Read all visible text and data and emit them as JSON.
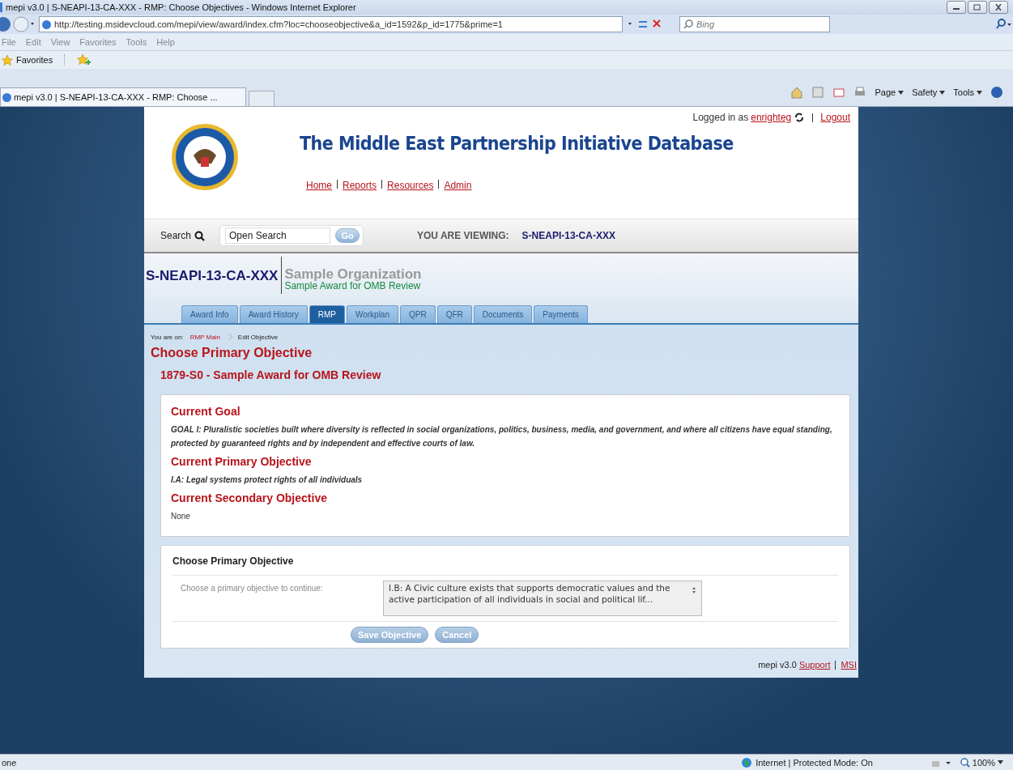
{
  "browser": {
    "title": "mepi v3.0 | S-NEAPI-13-CA-XXX - RMP: Choose Objectives - Windows Internet Explorer",
    "url": "http://testing.msidevcloud.com/mepi/view/award/index.cfm?loc=chooseobjective&a_id=1592&p_id=1775&prime=1",
    "search_placeholder": "Bing",
    "menu": [
      "File",
      "Edit",
      "View",
      "Favorites",
      "Tools",
      "Help"
    ],
    "favorites": "Favorites",
    "tab_title": "mepi v3.0 | S-NEAPI-13-CA-XXX - RMP: Choose ...",
    "commands": [
      "Page",
      "Safety",
      "Tools"
    ],
    "status_left": "one",
    "status_zone": "Internet | Protected Mode: On",
    "zoom": "100%"
  },
  "header": {
    "logged_in_label": "Logged in as",
    "user": "enrighteg",
    "logout": "Logout",
    "site_title": "The Middle East Partnership Initiative Database",
    "nav": [
      "Home",
      "Reports",
      "Resources",
      "Admin"
    ]
  },
  "search": {
    "label": "Search",
    "placeholder": "Open Search",
    "go": "Go",
    "viewing_label": "YOU ARE VIEWING:",
    "viewing_value": "S-NEAPI-13-CA-XXX"
  },
  "award": {
    "code": "S-NEAPI-13-CA-XXX",
    "organization": "Sample Organization",
    "award_name": "Sample Award for OMB Review"
  },
  "tabs": [
    {
      "label": "Award Info",
      "selected": false
    },
    {
      "label": "Award History",
      "selected": false
    },
    {
      "label": "RMP",
      "selected": true
    },
    {
      "label": "Workplan",
      "selected": false
    },
    {
      "label": "QPR",
      "selected": false
    },
    {
      "label": "QFR",
      "selected": false
    },
    {
      "label": "Documents",
      "selected": false
    },
    {
      "label": "Payments",
      "selected": false
    }
  ],
  "breadcrumb": {
    "label": "You are on:",
    "link": "RMP Main",
    "current": "Edit Objective"
  },
  "page_title": "Choose Primary Objective",
  "award_heading": "1879-S0 - Sample Award for OMB Review",
  "current": [
    {
      "heading": "Current Goal",
      "text": "GOAL I: Pluralistic societies built where diversity is reflected in social organizations, politics, business, media, and government, and where all citizens have equal standing, protected by guaranteed rights and by independent and effective courts of law.",
      "italic": true
    },
    {
      "heading": "Current Primary Objective",
      "text": "I.A: Legal systems protect rights of all individuals",
      "italic": true
    },
    {
      "heading": "Current Secondary Objective",
      "text": "None",
      "italic": false
    }
  ],
  "form": {
    "title": "Choose Primary Objective",
    "label": "Choose a primary objective to continue:",
    "value": "I.B: A Civic culture exists that supports democratic values and the active participation of all individuals in social and political lif...",
    "buttons": [
      "Save Objective",
      "Cancel"
    ]
  },
  "footer": {
    "version": "mepi v3.0",
    "links": [
      "Support",
      "MSI"
    ]
  }
}
